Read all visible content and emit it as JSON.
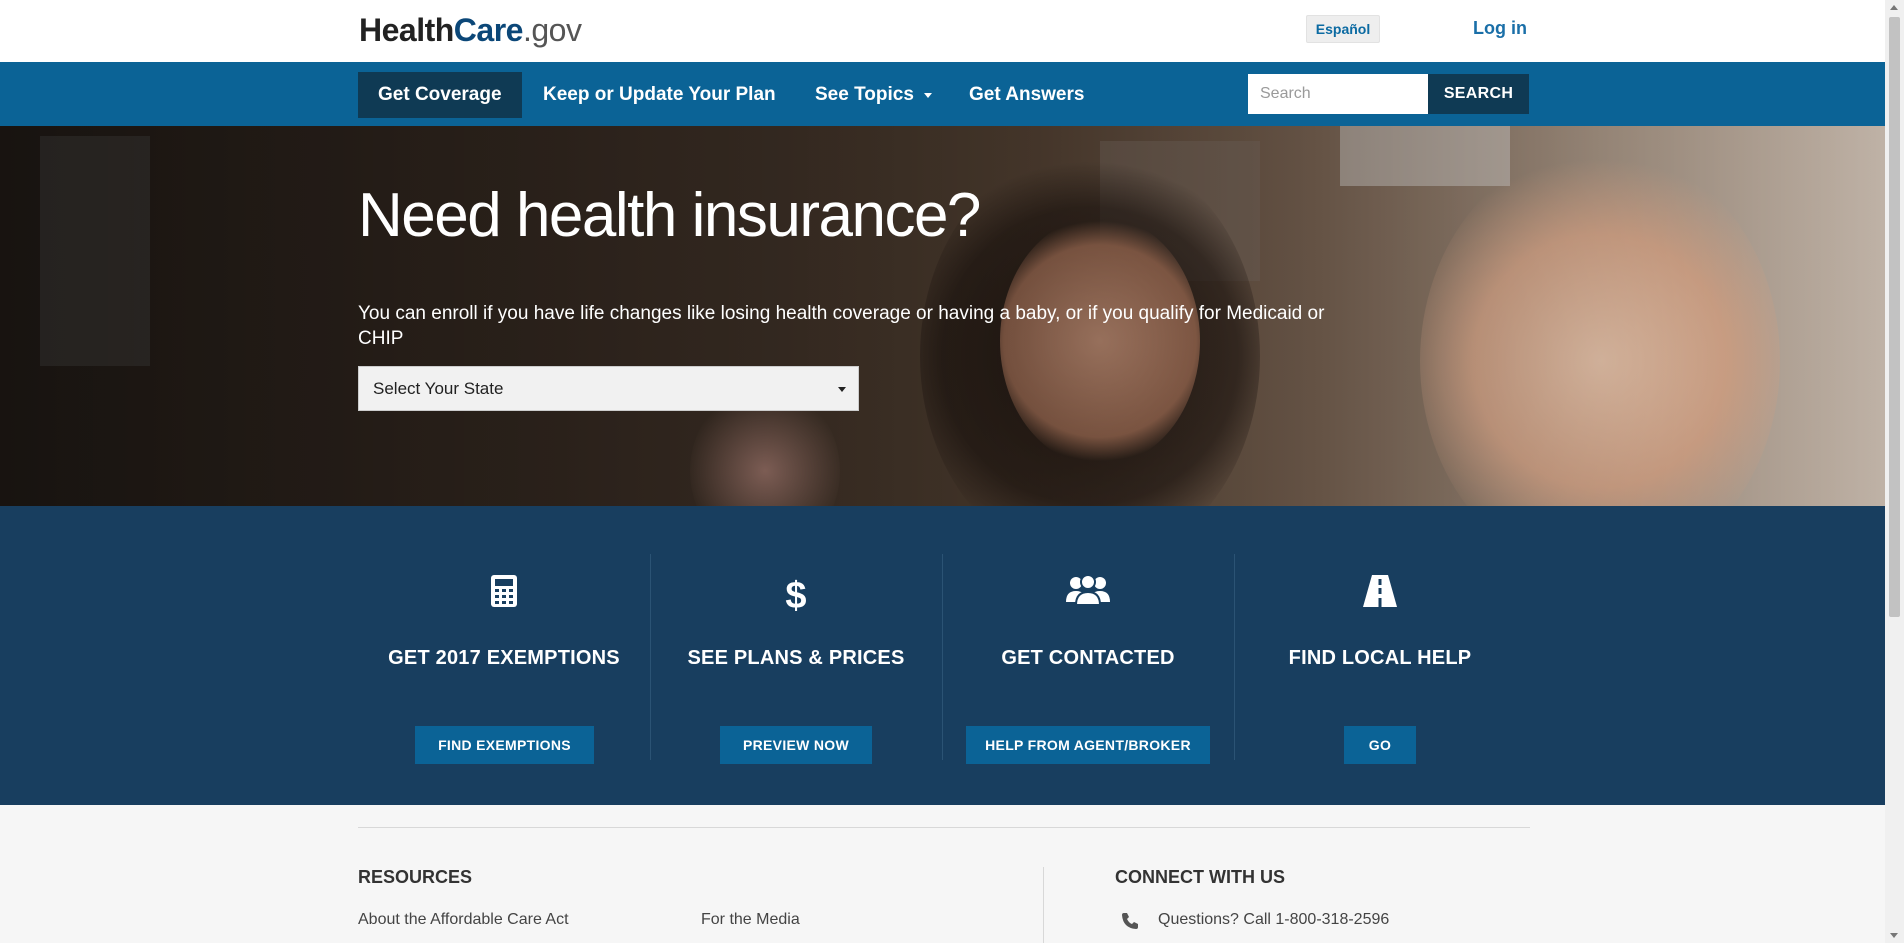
{
  "header": {
    "logo": {
      "part1": "Health",
      "part2": "Care",
      "part3": ".gov"
    },
    "language_label": "Español",
    "login_label": "Log in"
  },
  "nav": {
    "items": [
      {
        "label": "Get Coverage",
        "active": true
      },
      {
        "label": "Keep or Update Your Plan",
        "active": false
      },
      {
        "label": "See Topics",
        "active": false,
        "has_dropdown": true
      },
      {
        "label": "Get Answers",
        "active": false
      }
    ],
    "search": {
      "placeholder": "Search",
      "value": "",
      "button_label": "SEARCH"
    }
  },
  "hero": {
    "title": "Need health insurance?",
    "text": "You can enroll if you have life changes like losing health coverage or having a baby, or if you qualify for Medicaid or CHIP",
    "state_select": {
      "selected": "Select Your State"
    }
  },
  "actions": [
    {
      "icon": "calculator-icon",
      "title": "GET 2017 EXEMPTIONS",
      "button": "FIND EXEMPTIONS"
    },
    {
      "icon": "dollar-icon",
      "title": "SEE PLANS & PRICES",
      "button": "PREVIEW NOW"
    },
    {
      "icon": "people-icon",
      "title": "GET CONTACTED",
      "button": "HELP FROM AGENT/BROKER"
    },
    {
      "icon": "road-icon",
      "title": "FIND LOCAL HELP",
      "button": "GO"
    }
  ],
  "footer": {
    "resources_heading": "RESOURCES",
    "resources_links": [
      "About the Affordable Care Act",
      "For the Media"
    ],
    "connect_heading": "CONNECT WITH US",
    "phone_text": "Questions? Call 1-800-318-2596"
  },
  "colors": {
    "nav_bg": "#0b6396",
    "nav_active": "#0f3a54",
    "actions_bg": "#183e5f",
    "link_blue": "#1a6fa8"
  }
}
